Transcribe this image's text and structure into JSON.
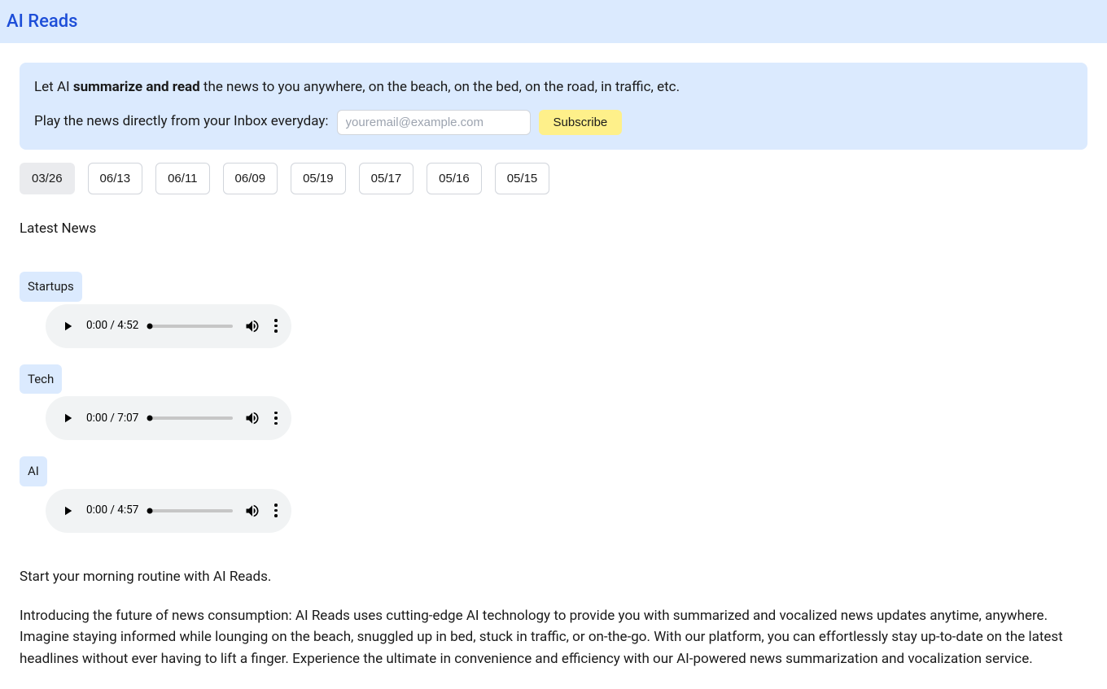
{
  "header": {
    "title": "AI Reads"
  },
  "hero": {
    "line1_prefix": "Let AI ",
    "line1_bold": "summarize and read",
    "line1_suffix": " the news to you anywhere, on the beach, on the bed, on the road, in traffic, etc.",
    "line2_text": "Play the news directly from your Inbox everyday:",
    "email_placeholder": "youremail@example.com",
    "subscribe_label": "Subscribe"
  },
  "dates": [
    {
      "label": "03/26",
      "active": true
    },
    {
      "label": "06/13",
      "active": false
    },
    {
      "label": "06/11",
      "active": false
    },
    {
      "label": "06/09",
      "active": false
    },
    {
      "label": "05/19",
      "active": false
    },
    {
      "label": "05/17",
      "active": false
    },
    {
      "label": "05/16",
      "active": false
    },
    {
      "label": "05/15",
      "active": false
    }
  ],
  "section_title": "Latest News",
  "categories": [
    {
      "name": "Startups",
      "current": "0:00",
      "duration": "4:52"
    },
    {
      "name": "Tech",
      "current": "0:00",
      "duration": "7:07"
    },
    {
      "name": "AI",
      "current": "0:00",
      "duration": "4:57"
    }
  ],
  "morning_text": "Start your morning routine with AI Reads.",
  "intro_para": "Introducing the future of news consumption: AI Reads uses cutting-edge AI technology to provide you with summarized and vocalized news updates anytime, anywhere. Imagine staying informed while lounging on the beach, snuggled up in bed, stuck in traffic, or on-the-go. With our platform, you can effortlessly stay up-to-date on the latest headlines without ever having to lift a finger. Experience the ultimate in convenience and efficiency with our AI-powered news summarization and vocalization service."
}
